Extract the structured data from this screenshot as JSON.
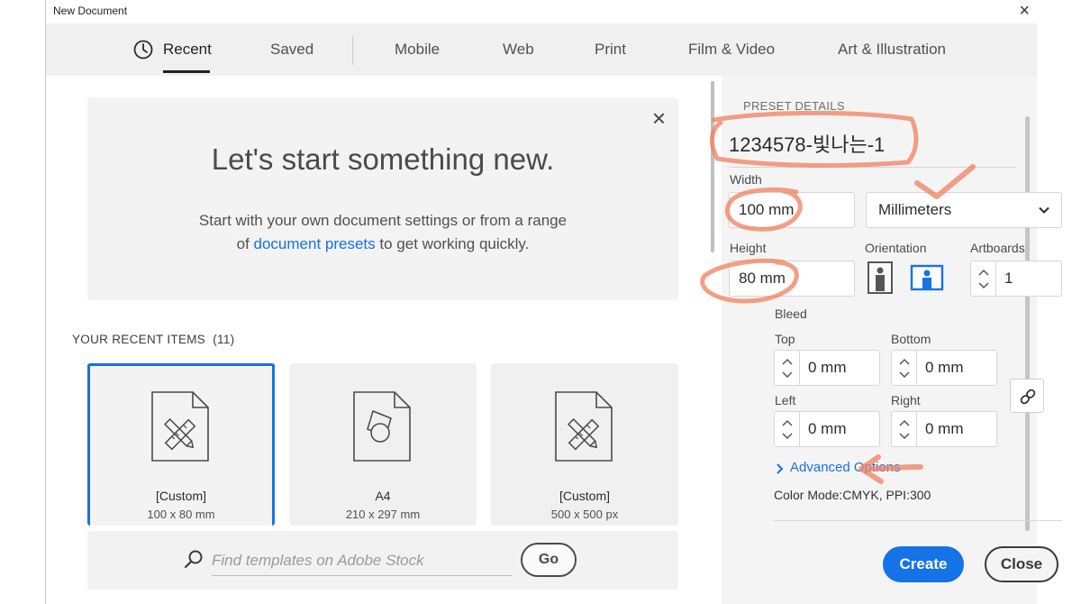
{
  "window": {
    "title": "New Document",
    "close_label": "×"
  },
  "tabs": [
    {
      "label": "Recent",
      "active": true
    },
    {
      "label": "Saved"
    },
    {
      "label": "Mobile"
    },
    {
      "label": "Web"
    },
    {
      "label": "Print"
    },
    {
      "label": "Film & Video"
    },
    {
      "label": "Art & Illustration"
    }
  ],
  "welcome": {
    "heading": "Let's start something new.",
    "text_before": "Start with your own document settings or from a range of ",
    "link": "document presets",
    "text_after": " to get working quickly.",
    "close_label": "×"
  },
  "recent": {
    "heading": "YOUR RECENT ITEMS",
    "count": "(11)",
    "items": [
      {
        "name": "[Custom]",
        "size": "100 x 80 mm",
        "icon": "pencil-ruler-icon",
        "selected": true
      },
      {
        "name": "A4",
        "size": "210 x 297 mm",
        "icon": "shapes-icon"
      },
      {
        "name": "[Custom]",
        "size": "500 x 500 px",
        "icon": "pencil-ruler-icon"
      }
    ]
  },
  "stock": {
    "placeholder": "Find templates on Adobe Stock",
    "go_label": "Go"
  },
  "preset": {
    "heading": "PRESET DETAILS",
    "name": "1234578-빛나는-1",
    "width_label": "Width",
    "width_value": "100 mm",
    "units": "Millimeters",
    "height_label": "Height",
    "height_value": "80 mm",
    "orientation_label": "Orientation",
    "orientation_selected": "landscape",
    "artboards_label": "Artboards",
    "artboards_value": "1",
    "bleed_label": "Bleed",
    "bleed": {
      "top_label": "Top",
      "top": "0 mm",
      "bottom_label": "Bottom",
      "bottom": "0 mm",
      "left_label": "Left",
      "left": "0 mm",
      "right_label": "Right",
      "right": "0 mm"
    },
    "advanced_label": "Advanced Options",
    "color_mode": "Color Mode:CMYK, PPI:300"
  },
  "buttons": {
    "create": "Create",
    "close": "Close"
  },
  "colors": {
    "accent": "#1473e6",
    "annotation": "#f08060"
  }
}
